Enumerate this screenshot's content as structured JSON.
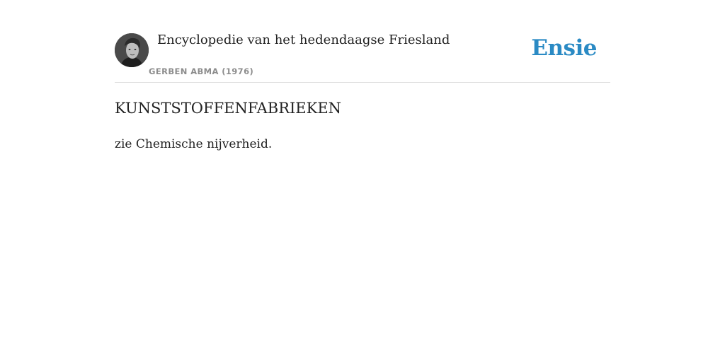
{
  "header": {
    "book_title": "Encyclopedie van het hedendaagse Friesland",
    "author": "GERBEN ABMA (1976)",
    "brand": "Ensie",
    "brand_color": "#2a8ac4",
    "avatar_icon": "author-portrait"
  },
  "entry": {
    "title": "KUNSTSTOFFENFABRIEKEN",
    "body": "zie Chemische nijverheid."
  }
}
